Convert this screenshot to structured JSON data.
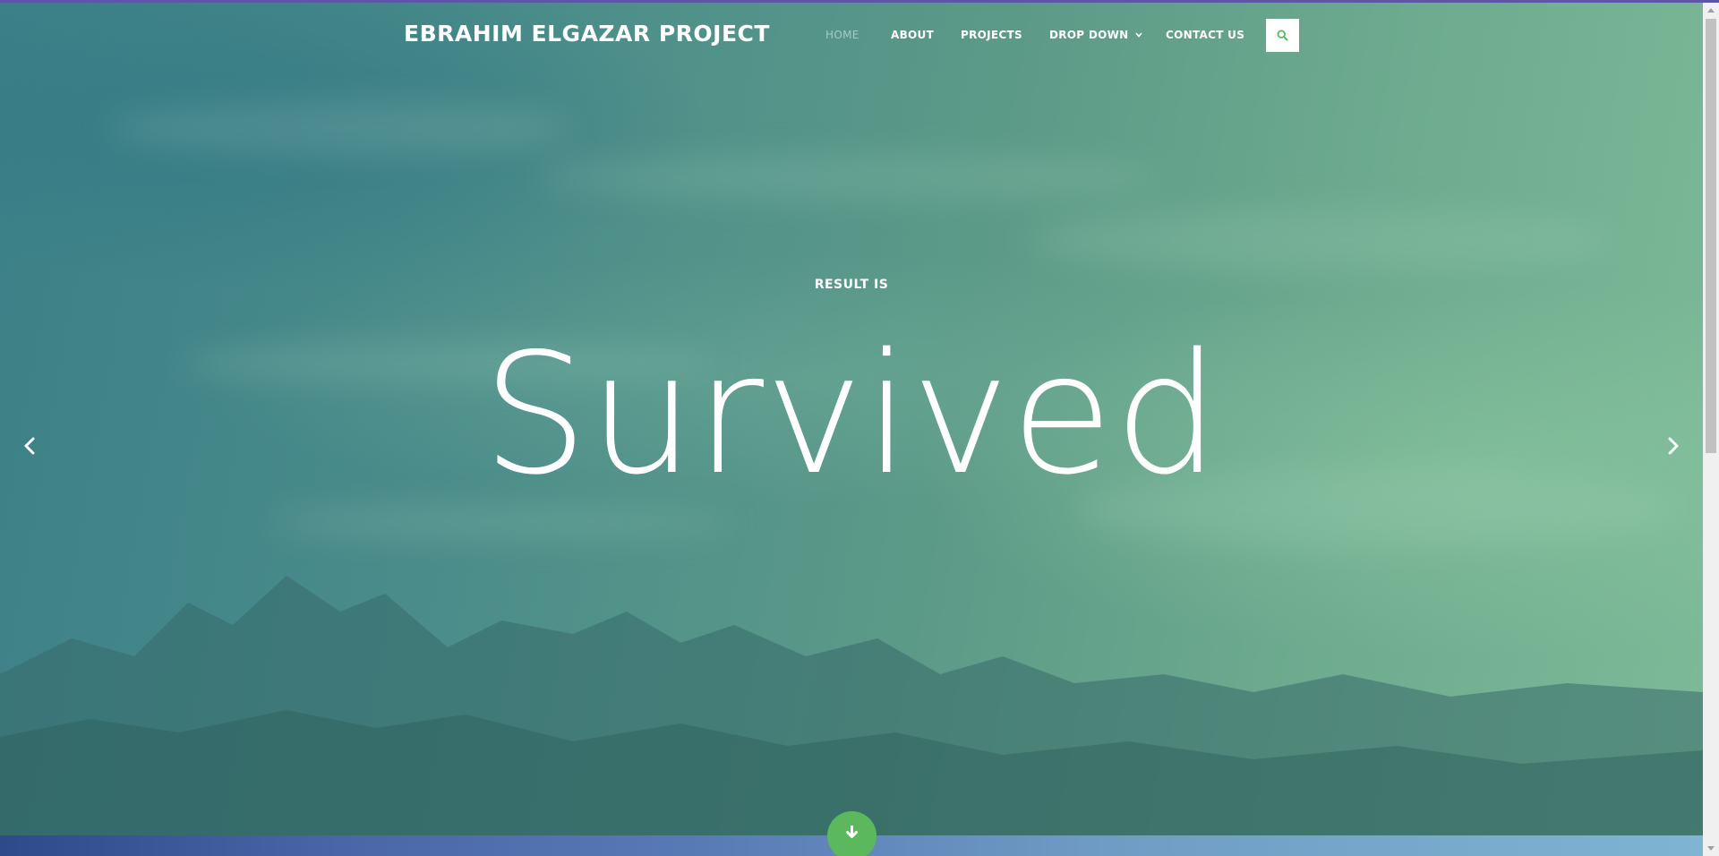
{
  "site": {
    "brand": "EBRAHIM ELGAZAR PROJECT"
  },
  "nav": {
    "items": [
      {
        "label": "HOME",
        "active": true
      },
      {
        "label": "ABOUT",
        "active": false
      },
      {
        "label": "PROJECTS",
        "active": false
      },
      {
        "label": "DROP DOWN",
        "active": false,
        "has_dropdown": true
      },
      {
        "label": "CONTACT US",
        "active": false
      }
    ],
    "search_icon": "search-icon",
    "dropdown_icon": "chevron-down-icon"
  },
  "hero": {
    "subtitle": "RESULT IS",
    "headline": "Survived",
    "prev_icon": "chevron-left-icon",
    "next_icon": "chevron-right-icon",
    "scroll_icon": "arrow-down-icon"
  },
  "colors": {
    "accent": "#5cb85c",
    "nav_active": "#a8c8cc",
    "text": "#ffffff",
    "top_border": "#5b57a6"
  }
}
